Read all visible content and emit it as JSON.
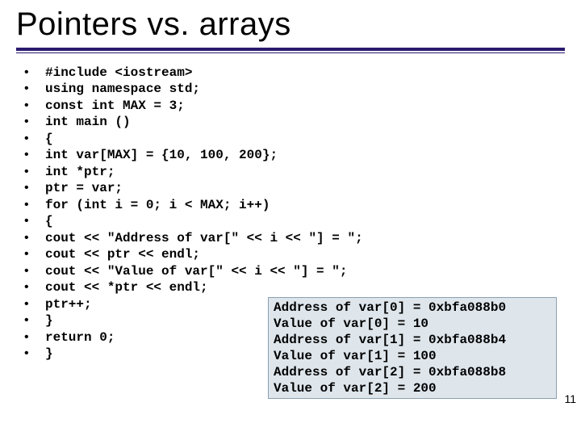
{
  "title": "Pointers vs. arrays",
  "code_lines": [
    "#include <iostream>",
    "using namespace std;",
    "const int MAX = 3;",
    "int main ()",
    "{",
    "int var[MAX] = {10, 100, 200};",
    "int *ptr;",
    "ptr = var;",
    "for (int i = 0; i < MAX; i++)",
    "{",
    "cout << \"Address of var[\" << i << \"] = \";",
    "cout << ptr << endl;",
    "cout << \"Value of var[\" << i << \"] = \";",
    "cout << *ptr << endl;",
    "ptr++;",
    "}",
    "return 0;",
    "}"
  ],
  "output_lines": [
    "Address of var[0] = 0xbfa088b0",
    "Value of var[0] = 10",
    "Address of var[1] = 0xbfa088b4",
    "Value of var[1] = 100",
    "Address of var[2] = 0xbfa088b8",
    "Value of var[2] = 200"
  ],
  "page_number": "11"
}
